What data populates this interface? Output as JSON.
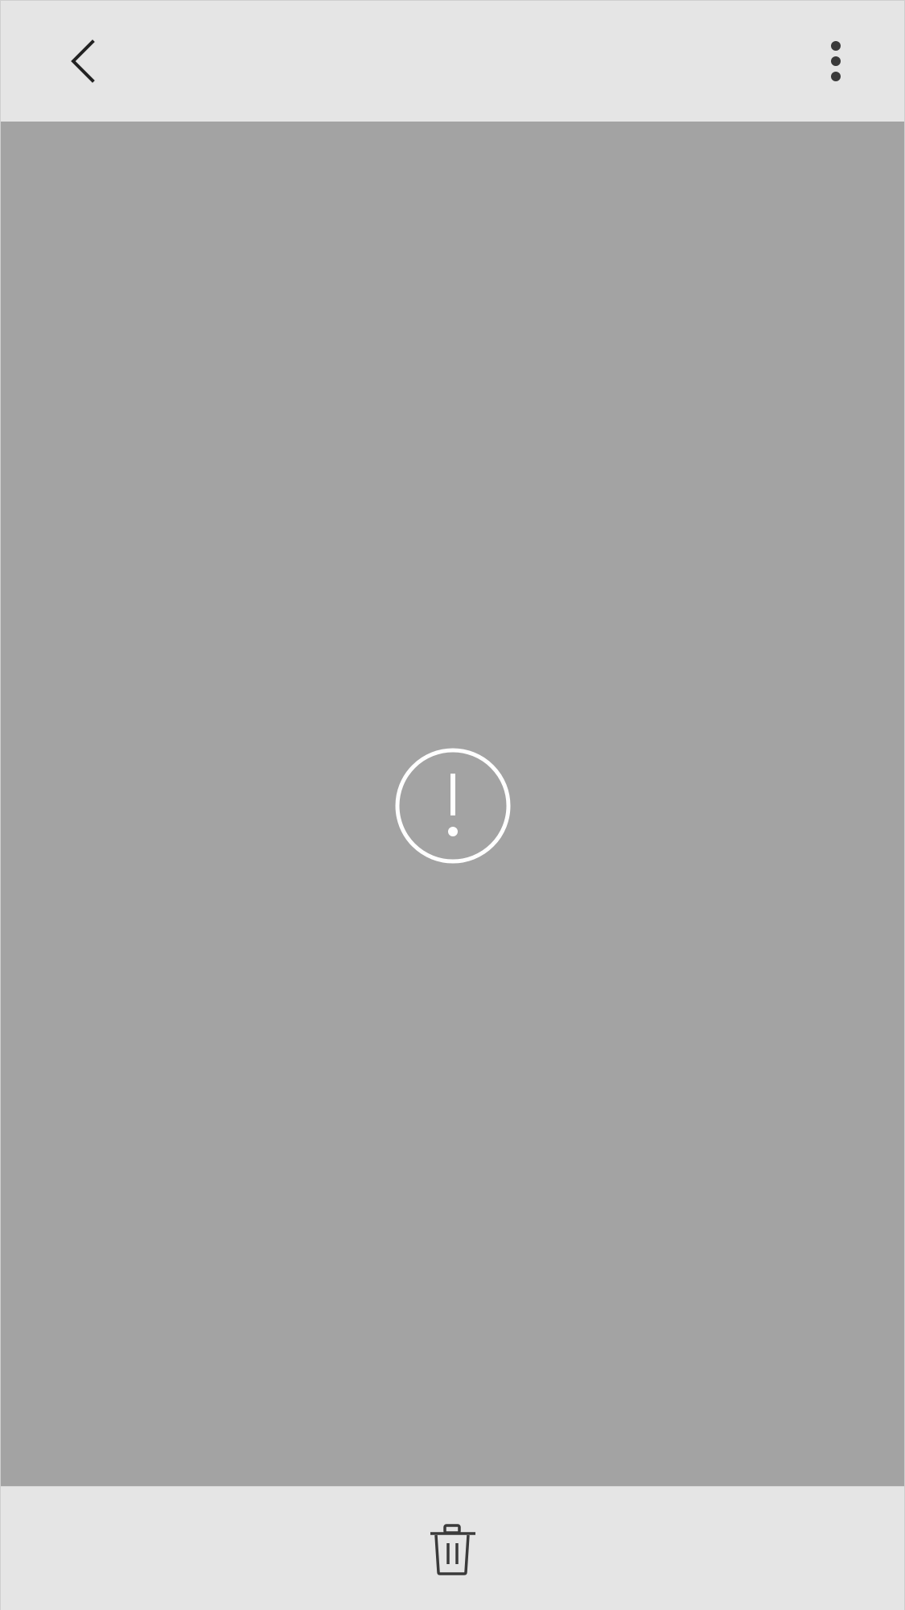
{
  "top_bar": {
    "back_icon": "chevron-left-icon",
    "more_icon": "more-vertical-icon"
  },
  "media_viewer": {
    "status_icon": "alert-circle-icon",
    "background": "#a3a3a3"
  },
  "bottom_bar": {
    "delete_icon": "trash-icon"
  },
  "colors": {
    "bar_background": "#e5e5e5",
    "icon_dark": "#222222",
    "icon_gray": "#3a3a3a",
    "alert_icon": "#ffffff"
  }
}
